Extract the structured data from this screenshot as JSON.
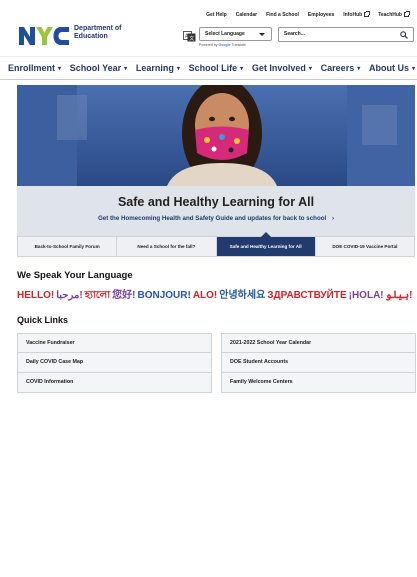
{
  "header": {
    "logo_line1": "Department of",
    "logo_line2": "Education",
    "utility_links": [
      "Get Help",
      "Calendar",
      "Find a School",
      "Employees",
      "InfoHub",
      "TeachHub"
    ],
    "language_select": "Select Language",
    "powered_by": "Powered by",
    "powered_brand": "Google",
    "powered_service": "Translate",
    "search_placeholder": "Search..."
  },
  "nav": {
    "items": [
      "Enrollment",
      "School Year",
      "Learning",
      "School Life",
      "Get Involved",
      "Careers",
      "About Us"
    ]
  },
  "hero": {
    "title": "Safe and Healthy Learning for All",
    "subtitle": "Get the Homecoming Health and Safety Guide and updates for back to school",
    "arrow": "›"
  },
  "tabs": {
    "items": [
      "Back-to-School Family Forum",
      "Need a School for the fall?",
      "Safe and Healthy Learning for All",
      "DOE COVID-19 Vaccine Portal"
    ],
    "active_index": 2
  },
  "languages": {
    "heading": "We Speak Your Language",
    "greetings": [
      {
        "text": "HELLO!",
        "color": "#d6202a"
      },
      {
        "text": "مرحبا!",
        "color": "#7b3fa0"
      },
      {
        "text": "হ্যালো",
        "color": "#d6202a"
      },
      {
        "text": "您好!",
        "color": "#7b3fa0"
      },
      {
        "text": "BONJOUR!",
        "color": "#2358a8"
      },
      {
        "text": "ALO!",
        "color": "#d6202a"
      },
      {
        "text": "안녕하세요",
        "color": "#2358a8"
      },
      {
        "text": "ЗДРАВСТВУЙТЕ",
        "color": "#d6202a"
      },
      {
        "text": "¡HOLA!",
        "color": "#7b3fa0"
      },
      {
        "text": "ہیلو!",
        "color": "#d6202a"
      }
    ]
  },
  "quick_links": {
    "heading": "Quick Links",
    "left": [
      "Vaccine Fundraiser",
      "Daily COVID Case Map",
      "COVID Information"
    ],
    "right": [
      "2021-2022 School Year Calendar",
      "DOE Student Accounts",
      "Family Welcome Centers"
    ]
  },
  "colors": {
    "brand_navy": "#223a6d",
    "logo_blue": "#1f4f9c",
    "logo_green": "#9bc53d",
    "accent_red": "#d6202a"
  }
}
